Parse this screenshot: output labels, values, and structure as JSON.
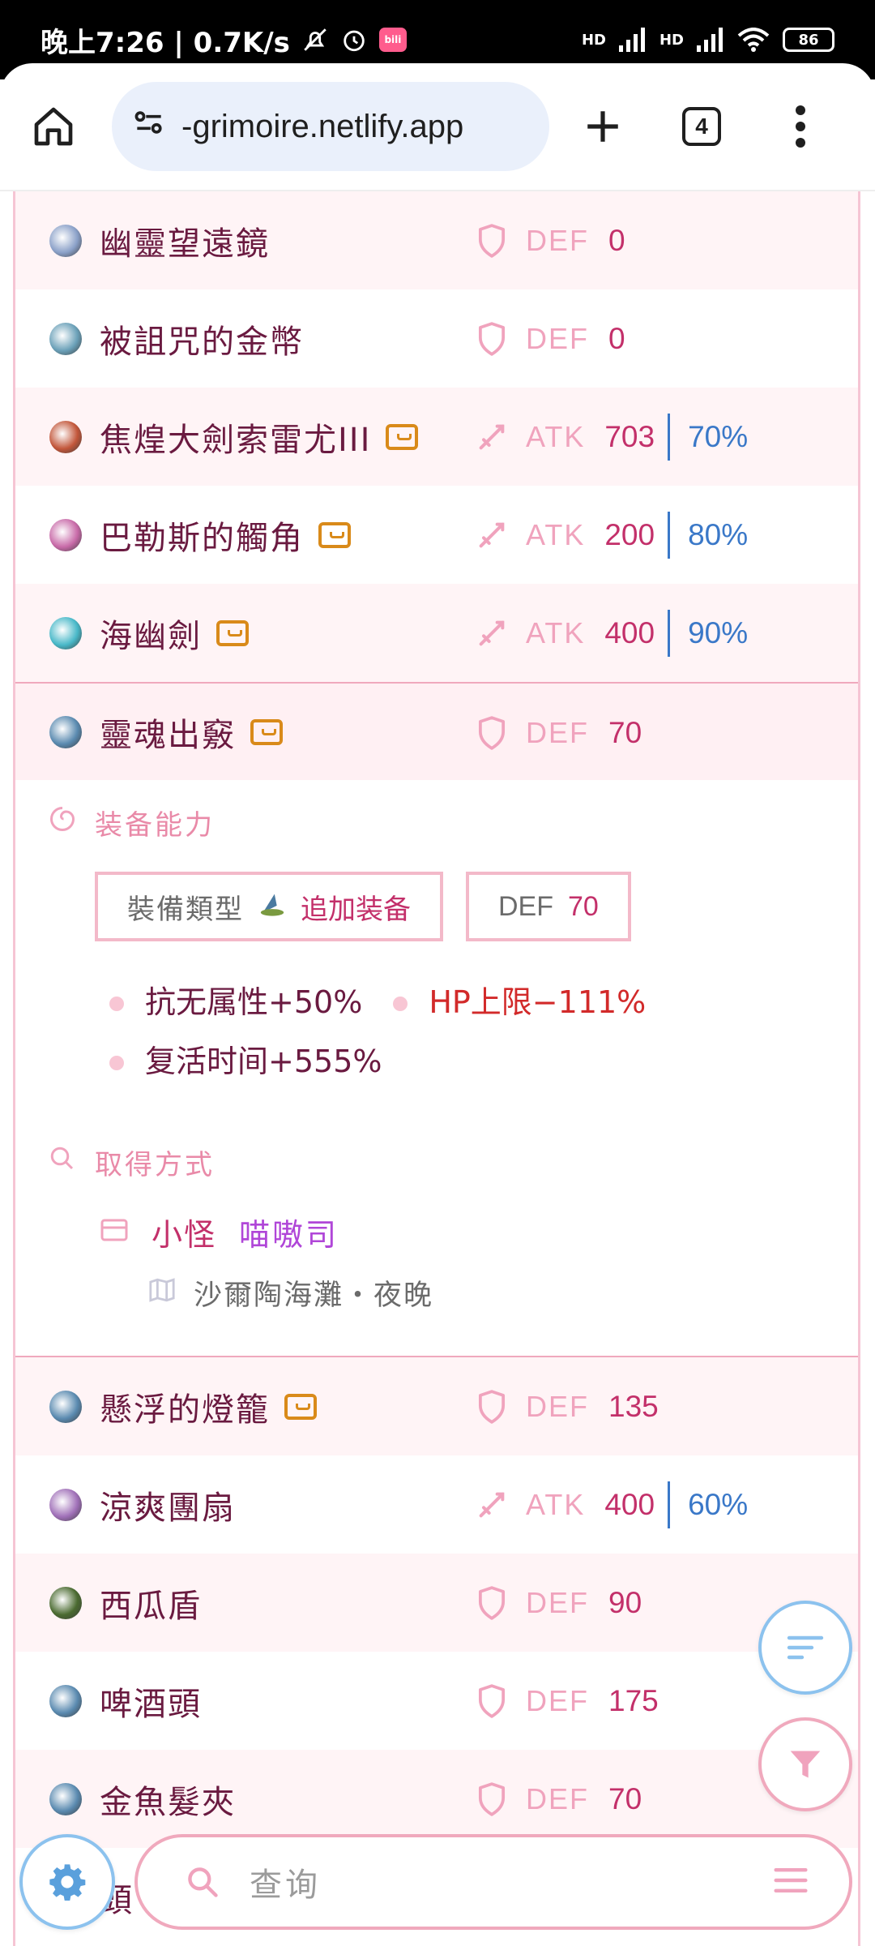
{
  "status_bar": {
    "time": "晚上7:26 | 0.7K/s",
    "signal_1": "HD",
    "signal_2": "HD",
    "battery": "86"
  },
  "browser": {
    "url": "-grimoire.netlify.app",
    "tab_count": "4"
  },
  "items": [
    {
      "name": "幽靈望遠鏡",
      "stat_type": "DEF",
      "value": "0",
      "chest": false,
      "kind": "def",
      "icon_color": "#8aa0c8"
    },
    {
      "name": "被詛咒的金幣",
      "stat_type": "DEF",
      "value": "0",
      "chest": false,
      "kind": "def",
      "icon_color": "#6aa0b8"
    },
    {
      "name": "焦煌大劍索雷尤III",
      "stat_type": "ATK",
      "value": "703",
      "pct": "70%",
      "chest": true,
      "kind": "atk",
      "icon_color": "#c2563a"
    },
    {
      "name": "巴勒斯的觸角",
      "stat_type": "ATK",
      "value": "200",
      "pct": "80%",
      "chest": true,
      "kind": "atk",
      "icon_color": "#c86aa8"
    },
    {
      "name": "海幽劍",
      "stat_type": "ATK",
      "value": "400",
      "pct": "90%",
      "chest": true,
      "kind": "atk",
      "icon_color": "#48b8c8"
    },
    {
      "name": "靈魂出竅",
      "stat_type": "DEF",
      "value": "70",
      "chest": true,
      "kind": "def",
      "icon_color": "#5a8ab0"
    }
  ],
  "detail": {
    "ability_title": "装备能力",
    "equip_type_label": "裝備類型",
    "equip_type_value": "追加装备",
    "def_label": "DEF",
    "def_value": "70",
    "effects": [
      {
        "text": "抗无属性+50%",
        "negative": false
      },
      {
        "text": "HP上限−111%",
        "negative": true
      },
      {
        "text": "复活时间+555%",
        "negative": false
      }
    ],
    "obtain_title": "取得方式",
    "source_type": "小怪",
    "source_name": "喵嗷司",
    "location": "沙爾陶海灘・夜晚"
  },
  "items_after": [
    {
      "name": "懸浮的燈籠",
      "stat_type": "DEF",
      "value": "135",
      "chest": true,
      "kind": "def",
      "icon_color": "#5a8ab0"
    },
    {
      "name": "涼爽團扇",
      "stat_type": "ATK",
      "value": "400",
      "pct": "60%",
      "chest": false,
      "kind": "atk",
      "icon_color": "#a070b8"
    },
    {
      "name": "西瓜盾",
      "stat_type": "DEF",
      "value": "90",
      "chest": false,
      "kind": "def",
      "icon_color": "#4a6a30"
    },
    {
      "name": "啤酒頭",
      "stat_type": "DEF",
      "value": "175",
      "chest": false,
      "kind": "def",
      "icon_color": "#5a8ab0"
    },
    {
      "name": "金魚髮夾",
      "stat_type": "DEF",
      "value": "70",
      "chest": false,
      "kind": "def",
      "icon_color": "#5a8ab0"
    },
    {
      "name": "頭",
      "stat_type": "",
      "value": "",
      "chest": false,
      "kind": "def",
      "icon_color": "#5a8ab0"
    }
  ],
  "search": {
    "placeholder": "查询"
  },
  "colors": {
    "accent_pink": "#f0a9bd",
    "accent_blue": "#8cc2ee",
    "value_pink": "#c3306a",
    "percent_blue": "#3a78c8",
    "chest_orange": "#d98a1a"
  }
}
